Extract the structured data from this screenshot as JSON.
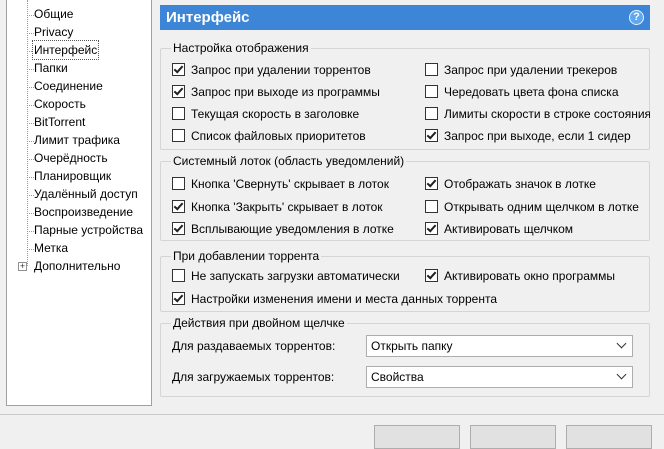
{
  "sidebar": {
    "items": [
      {
        "label": "Общие"
      },
      {
        "label": "Privacy"
      },
      {
        "label": "Интерфейс"
      },
      {
        "label": "Папки"
      },
      {
        "label": "Соединение"
      },
      {
        "label": "Скорость"
      },
      {
        "label": "BitTorrent"
      },
      {
        "label": "Лимит трафика"
      },
      {
        "label": "Очерёдность"
      },
      {
        "label": "Планировщик"
      },
      {
        "label": "Удалённый доступ"
      },
      {
        "label": "Воспроизведение"
      },
      {
        "label": "Парные устройства"
      },
      {
        "label": "Метка"
      },
      {
        "label": "Дополнительно"
      }
    ],
    "selected": "Интерфейс",
    "expander_symbol": "+"
  },
  "header": {
    "title": "Интерфейс",
    "help_icon": "?"
  },
  "display_settings": {
    "title": "Настройка отображения",
    "options": [
      {
        "label": "Запрос при удалении торрентов",
        "checked": true
      },
      {
        "label": "Запрос при удалении трекеров",
        "checked": false
      },
      {
        "label": "Запрос при выходе из программы",
        "checked": true
      },
      {
        "label": "Чередовать цвета фона списка",
        "checked": false
      },
      {
        "label": "Текущая скорость в заголовке",
        "checked": false
      },
      {
        "label": "Лимиты скорости в строке состояния",
        "checked": false
      },
      {
        "label": "Список файловых приоритетов",
        "checked": false
      },
      {
        "label": "Запрос при выходе, если 1 сидер",
        "checked": true
      }
    ]
  },
  "tray": {
    "title": "Системный лоток (область уведомлений)",
    "options": [
      {
        "label": "Кнопка 'Свернуть' скрывает в лоток",
        "checked": false
      },
      {
        "label": "Отображать значок в лотке",
        "checked": true
      },
      {
        "label": "Кнопка 'Закрыть' скрывает в лоток",
        "checked": true
      },
      {
        "label": "Открывать одним щелчком в лотке",
        "checked": false
      },
      {
        "label": "Всплывающие уведомления в лотке",
        "checked": true
      },
      {
        "label": "Активировать щелчком",
        "checked": true
      }
    ]
  },
  "add_torrent": {
    "title": "При добавлении торрента",
    "options": [
      {
        "label": "Не запускать загрузки автоматически",
        "checked": false
      },
      {
        "label": "Активировать окно программы",
        "checked": true
      },
      {
        "label": "Настройки изменения имени и места данных торрента",
        "checked": true
      }
    ]
  },
  "double_click": {
    "title": "Действия при двойном щелчке",
    "seeding_label": "Для раздаваемых торрентов:",
    "seeding_value": "Открыть папку",
    "downloading_label": "Для загружаемых торрентов:",
    "downloading_value": "Свойства"
  },
  "colors": {
    "header_bg": "#3d85d6",
    "window_bg": "#f0f0f0"
  }
}
